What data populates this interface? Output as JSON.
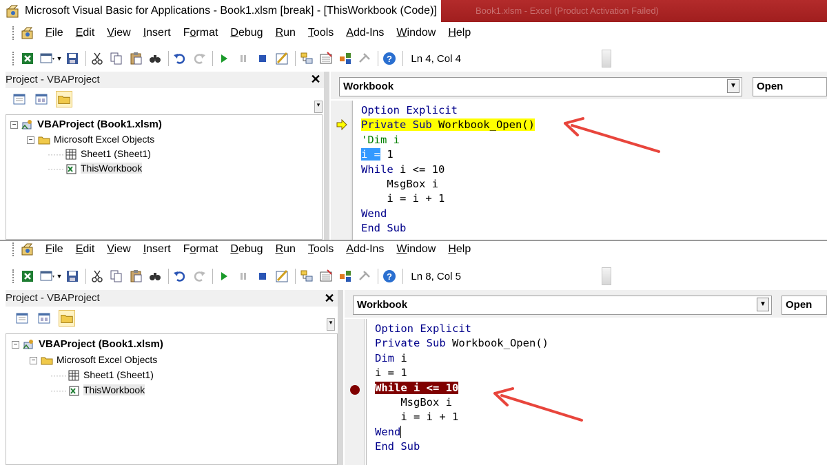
{
  "window": {
    "title": "Microsoft Visual Basic for Applications - Book1.xlsm [break] - [ThisWorkbook (Code)]",
    "background_title": "Book1.xlsm - Excel (Product Activation Failed)"
  },
  "menus": [
    "File",
    "Edit",
    "View",
    "Insert",
    "Format",
    "Debug",
    "Run",
    "Tools",
    "Add-Ins",
    "Window",
    "Help"
  ],
  "menu_underline": [
    "F",
    "E",
    "V",
    "I",
    "o",
    "D",
    "R",
    "T",
    "A",
    "W",
    "H"
  ],
  "top": {
    "status": "Ln 4, Col 4",
    "project_title": "Project - VBAProject",
    "close_glyph": "✕",
    "tree": {
      "root": "VBAProject (Book1.xlsm)",
      "folder": "Microsoft Excel Objects",
      "sheet": "Sheet1 (Sheet1)",
      "workbook": "ThisWorkbook"
    },
    "object_combo": "Workbook",
    "proc_combo": "Open",
    "code": [
      "Option Explicit",
      "Private Sub Workbook_Open()",
      "'Dim i",
      "i = 1",
      "While i <= 10",
      "    MsgBox i",
      "    i = i + 1",
      "Wend",
      "End Sub"
    ],
    "sel_part": "i =",
    "sel_rest": " 1"
  },
  "bottom": {
    "status": "Ln 8, Col 5",
    "project_title": "Project - VBAProject",
    "close_glyph": "✕",
    "tree": {
      "root": "VBAProject (Book1.xlsm)",
      "folder": "Microsoft Excel Objects",
      "sheet": "Sheet1 (Sheet1)",
      "workbook": "ThisWorkbook"
    },
    "object_combo": "Workbook",
    "proc_combo": "Open",
    "code": [
      "Option Explicit",
      "Private Sub Workbook_Open()",
      "Dim i",
      "i = 1",
      "While i <= 10",
      "    MsgBox i",
      "    i = i + 1",
      "Wend",
      "End Sub"
    ]
  },
  "colors": {
    "keyword": "#00008b",
    "comment": "#008000",
    "execution_highlight": "#ffff00",
    "breakpoint": "#800000",
    "annotation_arrow": "#e8453c"
  },
  "icons": [
    "vba-app-icon",
    "excel-view-icon",
    "insert-userform-icon",
    "save-icon",
    "cut-icon",
    "copy-icon",
    "paste-icon",
    "find-icon",
    "undo-icon",
    "redo-icon",
    "run-icon",
    "break-icon",
    "reset-icon",
    "design-mode-icon",
    "project-explorer-icon",
    "properties-icon",
    "object-browser-icon",
    "toolbox-icon",
    "help-icon",
    "breakpoint-icon",
    "execution-arrow-icon"
  ]
}
